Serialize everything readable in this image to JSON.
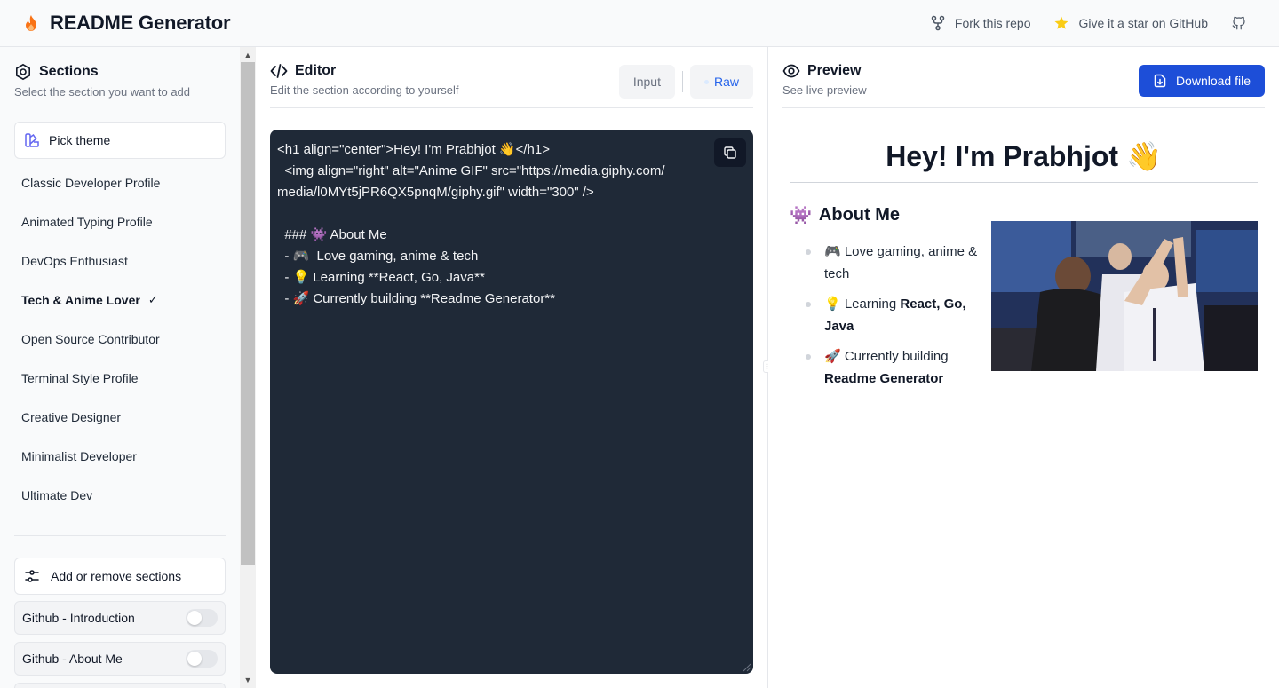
{
  "header": {
    "title": "README Generator",
    "fork_label": "Fork this repo",
    "star_label": "Give it a star on GitHub",
    "accent": "#f97316"
  },
  "sidebar": {
    "title": "Sections",
    "subtitle": "Select the section you want to add",
    "pick_theme": "Pick theme",
    "templates": [
      {
        "label": "Classic Developer Profile"
      },
      {
        "label": "Animated Typing Profile"
      },
      {
        "label": "DevOps Enthusiast"
      },
      {
        "label": "Tech & Anime Lover",
        "selected": true,
        "check": "✓"
      },
      {
        "label": "Open Source Contributor"
      },
      {
        "label": "Terminal Style Profile"
      },
      {
        "label": "Creative Designer"
      },
      {
        "label": "Minimalist Developer"
      },
      {
        "label": "Ultimate Dev"
      }
    ],
    "add_remove": "Add or remove sections",
    "sections": [
      {
        "label": "Github - Introduction",
        "enabled": false
      },
      {
        "label": "Github - About Me",
        "enabled": false
      }
    ]
  },
  "editor": {
    "title": "Editor",
    "subtitle": "Edit the section according to yourself",
    "tab_input": "Input",
    "tab_raw": "Raw",
    "code_lines": [
      "<h1 align=\"center\">Hey! I'm Prabhjot 👋</h1>",
      "  <img align=\"right\" alt=\"Anime GIF\" src=\"https://media.giphy.com/",
      "media/l0MYt5jPR6QX5pnqM/giphy.gif\" width=\"300\" />",
      "",
      "  ### 👾 About Me",
      "  - 🎮  Love gaming, anime & tech",
      "  - 💡 Learning **React, Go, Java**",
      "  - 🚀 Currently building **Readme Generator**"
    ]
  },
  "preview": {
    "title": "Preview",
    "subtitle": "See live preview",
    "download_label": "Download file",
    "h1": "Hey! I'm Prabhjot 👋",
    "h3_emoji": "👾",
    "h3_text": "About Me",
    "items": [
      {
        "prefix": "🎮 Love gaming, anime & tech",
        "bold": ""
      },
      {
        "prefix": "💡 Learning ",
        "bold": "React, Go, Java"
      },
      {
        "prefix": "🚀 Currently building ",
        "bold": "Readme Generator"
      }
    ],
    "primary": "#1d4ed8"
  }
}
